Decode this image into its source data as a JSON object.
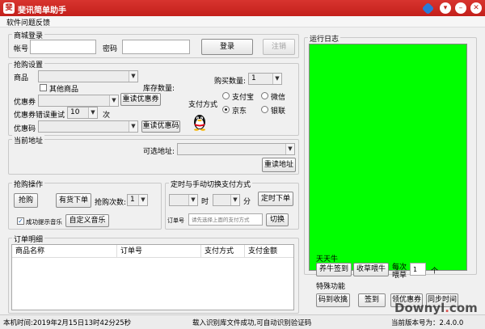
{
  "window": {
    "title": "斐讯简单助手",
    "icon_glyph": "斐"
  },
  "menu": {
    "items": [
      "软件问题反馈"
    ]
  },
  "login": {
    "group_title": "商城登录",
    "account_label": "帐号",
    "account_value": "",
    "password_label": "密码",
    "password_value": "",
    "login_button": "登录",
    "logout_button": "注销"
  },
  "purchase_settings": {
    "group_title": "抢购设置",
    "product_label": "商品",
    "product_value": "",
    "other_product_label": "其他商品",
    "stock_label": "库存数量:",
    "buy_qty_label": "购买数量:",
    "buy_qty_value": "1",
    "coupon_label": "优惠券",
    "coupon_value": "",
    "reload_coupon_button": "重读优惠券",
    "coupon_retry_label": "优惠券错误重试",
    "coupon_retry_value": "10",
    "coupon_retry_unit": "次",
    "promo_code_label": "优惠码",
    "promo_code_value": "",
    "reload_promo_button": "重读优惠码",
    "payment_label": "支付方式",
    "payment_options": [
      "支付宝",
      "微信",
      "京东",
      "银联"
    ],
    "payment_selected": "京东"
  },
  "address": {
    "group_title": "当前地址",
    "optional_label": "可选地址:",
    "optional_value": "",
    "reload_address_button": "重读地址"
  },
  "purchase_ops": {
    "group_title": "抢购操作",
    "grab_button": "抢购",
    "instock_button": "有货下单",
    "grab_count_label": "抢购次数:",
    "grab_count_value": "1",
    "success_sound_label": "成功提示音乐",
    "success_sound_checked": true,
    "custom_music_button": "自定义音乐"
  },
  "timer": {
    "group_title": "定时与手动切换支付方式",
    "hour_value": "",
    "hour_unit": "时",
    "minute_value": "",
    "minute_unit": "分",
    "timed_order_button": "定时下单",
    "order_no_label": "订单号",
    "order_no_placeholder": "请先选择上面的支付方式",
    "switch_button": "切换"
  },
  "orders": {
    "group_title": "订单明细",
    "columns": [
      "商品名称",
      "订单号",
      "支付方式",
      "支付金额"
    ]
  },
  "log": {
    "group_title": "运行日志",
    "background": "#00ff00"
  },
  "tiantianniu": {
    "group_title": "天天牛",
    "sign_button": "养牛签到",
    "harvest_button": "收草喂牛",
    "feed_label_top": "每次",
    "feed_label_bottom": "喂草",
    "feed_value": "1",
    "feed_unit": "个"
  },
  "special": {
    "group_title": "特殊功能",
    "captcha_button": "码到收擒",
    "sign_button": "签到",
    "claim_coupon_button": "领优惠券",
    "sync_time_button": "同步时间"
  },
  "status": {
    "time_text": "本机时间:2019年2月15日13时42分25秒",
    "message": "载入识别库文件成功,可自动识别验证码",
    "version": "当前版本号为：2.4.0.0"
  },
  "watermark": {
    "text_main": "Downyl",
    "text_dot": ".",
    "text_tail": "com"
  },
  "colors": {
    "titlebar": "#d8342f",
    "log_bg": "#00ff00"
  }
}
